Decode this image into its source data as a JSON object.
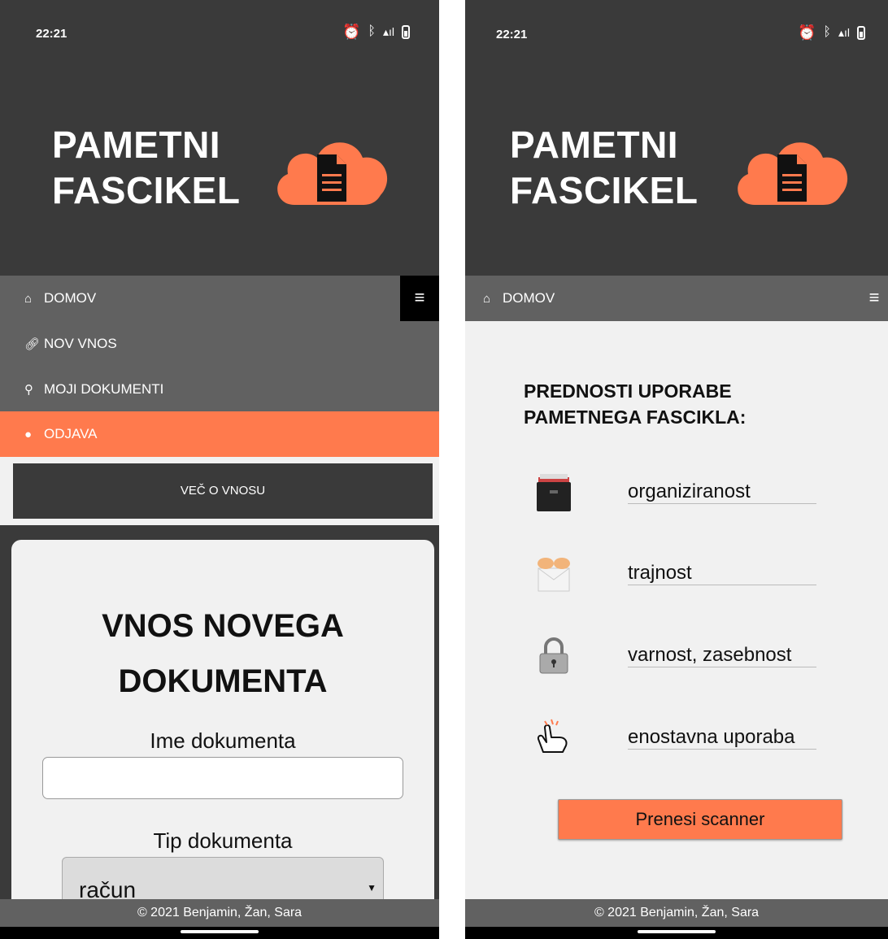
{
  "status_bar": {
    "time": "22:21"
  },
  "app": {
    "logo_line1": "PAMETNI",
    "logo_line2": "FASCIKEL",
    "brand_color": "#ff7a4d",
    "dark_color": "#3a3a3a"
  },
  "nav": {
    "home": "DOMOV",
    "menu_icon": "hamburger-icon",
    "items": [
      {
        "label": "NOV VNOS",
        "icon": "paperclip-icon"
      },
      {
        "label": "MOJI DOKUMENTI",
        "icon": "search-icon"
      },
      {
        "label": "ODJAVA",
        "icon": "user-icon",
        "active": true
      }
    ]
  },
  "left_page": {
    "more_button": "VEČ O VNOSU",
    "form_title_line1": "VNOS NOVEGA",
    "form_title_line2": "DOKUMENTA",
    "name_label": "Ime dokumenta",
    "name_value": "",
    "type_label": "Tip dokumenta",
    "type_value": "račun"
  },
  "right_page": {
    "heading_line1": "PREDNOSTI UPORABE",
    "heading_line2": "PAMETNEGA FASCIKLA:",
    "benefits": [
      {
        "label": "organiziranost",
        "icon": "file-box-icon"
      },
      {
        "label": "trajnost",
        "icon": "hands-envelope-icon"
      },
      {
        "label": "varnost, zasebnost",
        "icon": "lock-icon"
      },
      {
        "label": "enostavna uporaba",
        "icon": "pointing-hand-icon"
      }
    ],
    "scanner_button": "Prenesi scanner"
  },
  "footer": {
    "text": "© 2021 Benjamin, Žan, Sara"
  }
}
